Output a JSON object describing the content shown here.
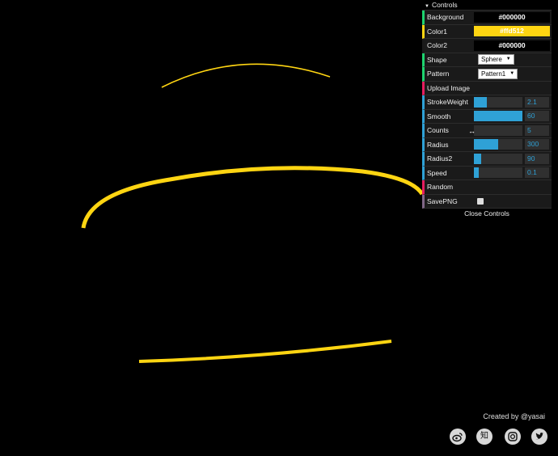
{
  "panel": {
    "title": "Controls",
    "close_label": "Close Controls",
    "rows": {
      "background": {
        "label": "Background",
        "value": "#000000",
        "swatch": "#000000"
      },
      "color1": {
        "label": "Color1",
        "value": "#ffd512",
        "swatch": "#ffd512"
      },
      "color2": {
        "label": "Color2",
        "value": "#000000",
        "swatch": "#000000"
      },
      "shape": {
        "label": "Shape",
        "value": "Sphere"
      },
      "pattern": {
        "label": "Pattern",
        "value": "Pattern1"
      },
      "upload": {
        "label": "Upload Image"
      },
      "strokeweight": {
        "label": "StrokeWeight",
        "value": "2.1",
        "fill": 0.27
      },
      "smooth": {
        "label": "Smooth",
        "value": "60",
        "fill": 1.0
      },
      "counts": {
        "label": "Counts",
        "value": "5",
        "fill": 0.0
      },
      "radius": {
        "label": "Radius",
        "value": "300",
        "fill": 0.5
      },
      "radius2": {
        "label": "Radius2",
        "value": "90",
        "fill": 0.15
      },
      "speed": {
        "label": "Speed",
        "value": "0.1",
        "fill": 0.1
      },
      "random": {
        "label": "Random"
      },
      "savepng": {
        "label": "SavePNG"
      }
    }
  },
  "footer": {
    "credit": "Created by @yasai",
    "icons": [
      "weibo-icon",
      "zhihu-icon",
      "instagram-icon",
      "twitter-icon"
    ],
    "zhihu_glyph": "知"
  },
  "colors": {
    "ring": "#ffd512",
    "slider": "#2fa1d6"
  }
}
